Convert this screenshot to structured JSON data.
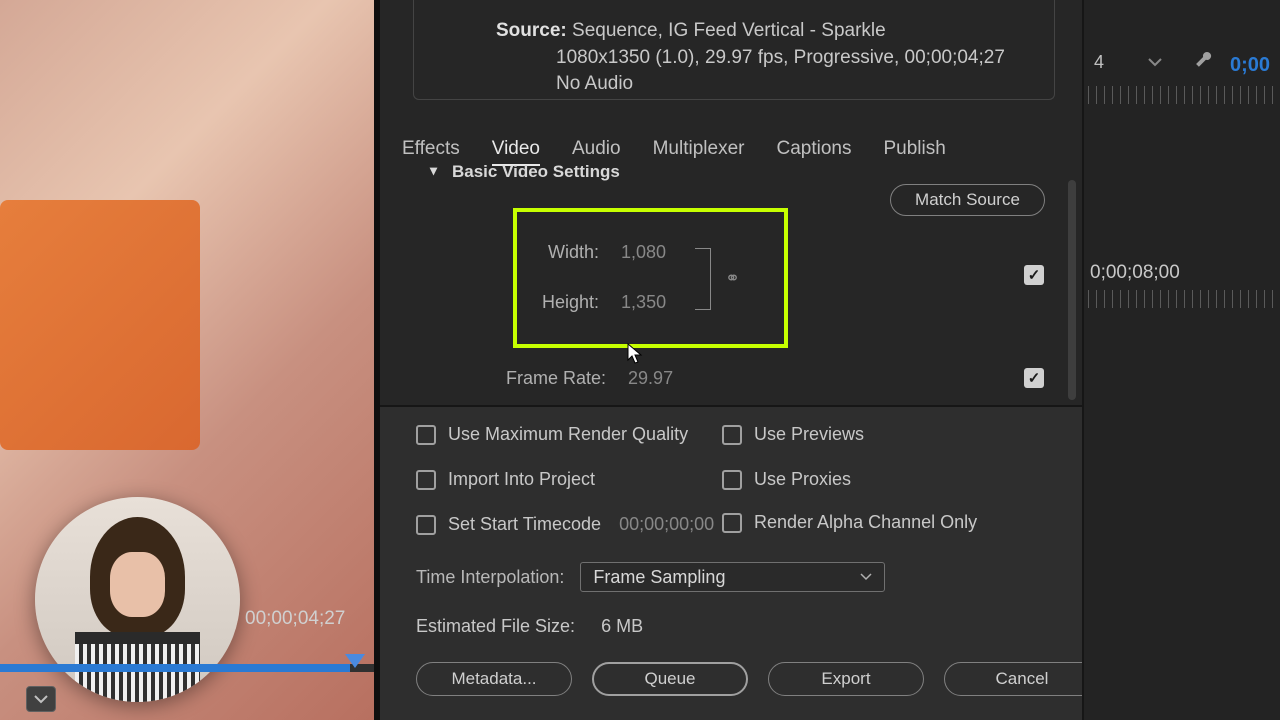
{
  "source": {
    "label": "Source:",
    "line1": "Sequence, IG Feed Vertical - Sparkle",
    "line2": "1080x1350 (1.0), 29.97 fps, Progressive, 00;00;04;27",
    "line3": "No Audio"
  },
  "tabs": {
    "effects": "Effects",
    "video": "Video",
    "audio": "Audio",
    "multiplexer": "Multiplexer",
    "captions": "Captions",
    "publish": "Publish"
  },
  "settings": {
    "header": "Basic Video Settings",
    "match_source": "Match Source",
    "width_label": "Width:",
    "width_value": "1,080",
    "height_label": "Height:",
    "height_value": "1,350",
    "framerate_label": "Frame Rate:",
    "framerate_value": "29.97"
  },
  "checkboxes": {
    "max_quality": "Use Maximum Render Quality",
    "previews": "Use Previews",
    "import": "Import Into Project",
    "proxies": "Use Proxies",
    "start_tc": "Set Start Timecode",
    "start_tc_value": "00;00;00;00",
    "alpha": "Render Alpha Channel Only"
  },
  "interp": {
    "label": "Time Interpolation:",
    "value": "Frame Sampling"
  },
  "estimate": {
    "label": "Estimated File Size:",
    "value": "6 MB"
  },
  "buttons": {
    "metadata": "Metadata...",
    "queue": "Queue",
    "export": "Export",
    "cancel": "Cancel"
  },
  "left": {
    "timecode": "00;00;04;27"
  },
  "right": {
    "num": "4",
    "tc1": "0;00",
    "tc2": "0;00;08;00"
  }
}
